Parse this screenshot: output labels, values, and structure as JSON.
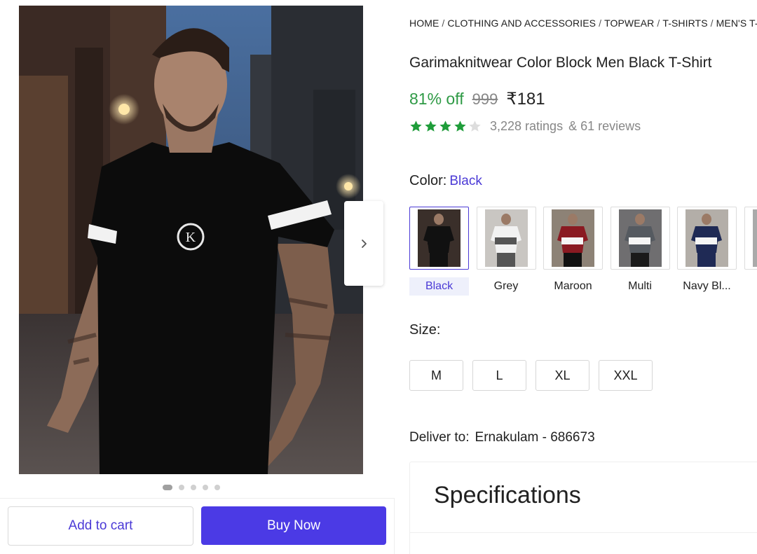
{
  "breadcrumb": [
    "HOME",
    "CLOTHING AND ACCESSORIES",
    "TOPWEAR",
    "T-SHIRTS",
    "MEN'S T-SHIRTS"
  ],
  "breadcrumb_separator": "/",
  "product": {
    "title": "Garimaknitwear Color Block Men Black T-Shirt",
    "discount": "81% off",
    "mrp": "999",
    "price": "₹181",
    "rating_stars": 4,
    "rating_max": 5,
    "ratings_count": "3,228 ratings",
    "reviews_count": "& 61 reviews"
  },
  "color": {
    "label": "Color:",
    "selected": "Black",
    "options": [
      {
        "name": "Black",
        "tee": "#111111",
        "band": "#111111",
        "bottom": "#111111",
        "bg": "#3a2f2a"
      },
      {
        "name": "Grey",
        "tee": "#f2f2f2",
        "band": "#555555",
        "bottom": "#555555",
        "bg": "#c9c6c2"
      },
      {
        "name": "Maroon",
        "tee": "#8a1a22",
        "band": "#f5f5f5",
        "bottom": "#111111",
        "bg": "#8d8276"
      },
      {
        "name": "Multi",
        "tee": "#555a60",
        "band": "#f5f5f5",
        "bottom": "#1a1a1a",
        "bg": "#6f6e70"
      },
      {
        "name": "Navy Bl...",
        "tee": "#1f2a55",
        "band": "#f5f5f5",
        "bottom": "#1f2a55",
        "bg": "#b3aea8"
      },
      {
        "name": "",
        "tee": "#777777",
        "band": "#bbbbbb",
        "bottom": "#444444",
        "bg": "#aaaaaa"
      }
    ]
  },
  "size": {
    "label": "Size:",
    "options": [
      "M",
      "L",
      "XL",
      "XXL"
    ]
  },
  "delivery": {
    "label": "Deliver to:",
    "location": "Ernakulam - 686673"
  },
  "specifications": {
    "title": "Specifications"
  },
  "actions": {
    "add_to_cart": "Add to cart",
    "buy_now": "Buy Now"
  },
  "carousel": {
    "total": 5,
    "active": 1
  },
  "colors": {
    "accent": "#4b3ad6",
    "buy_button": "#4b3ae5",
    "discount_green": "#2e9a45",
    "star_green": "#1f9d3a",
    "star_empty": "#dddddd"
  },
  "icons": {
    "next": "chevron-right-icon",
    "star": "star-icon"
  }
}
